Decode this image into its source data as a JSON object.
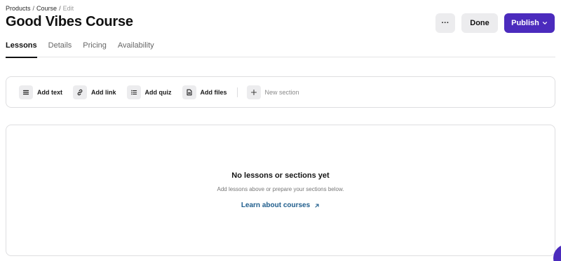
{
  "breadcrumb": {
    "items": [
      "Products",
      "Course"
    ],
    "current": "Edit",
    "separator": "/"
  },
  "page": {
    "title": "Good Vibes Course"
  },
  "header_actions": {
    "more_label": "···",
    "done_label": "Done",
    "publish_label": "Publish"
  },
  "tabs": [
    {
      "label": "Lessons",
      "active": true
    },
    {
      "label": "Details"
    },
    {
      "label": "Pricing"
    },
    {
      "label": "Availability"
    }
  ],
  "toolbar": {
    "items": [
      {
        "label": "Add text",
        "icon": "text-lines-icon"
      },
      {
        "label": "Add link",
        "icon": "link-icon"
      },
      {
        "label": "Add quiz",
        "icon": "list-icon"
      },
      {
        "label": "Add files",
        "icon": "file-icon"
      },
      {
        "label": "New section",
        "icon": "plus-icon"
      }
    ]
  },
  "empty_state": {
    "title": "No lessons or sections yet",
    "subtitle": "Add lessons above or prepare your sections below.",
    "link_label": "Learn about courses"
  },
  "colors": {
    "accent": "#4b2bbd",
    "link": "#1f5d8c"
  }
}
